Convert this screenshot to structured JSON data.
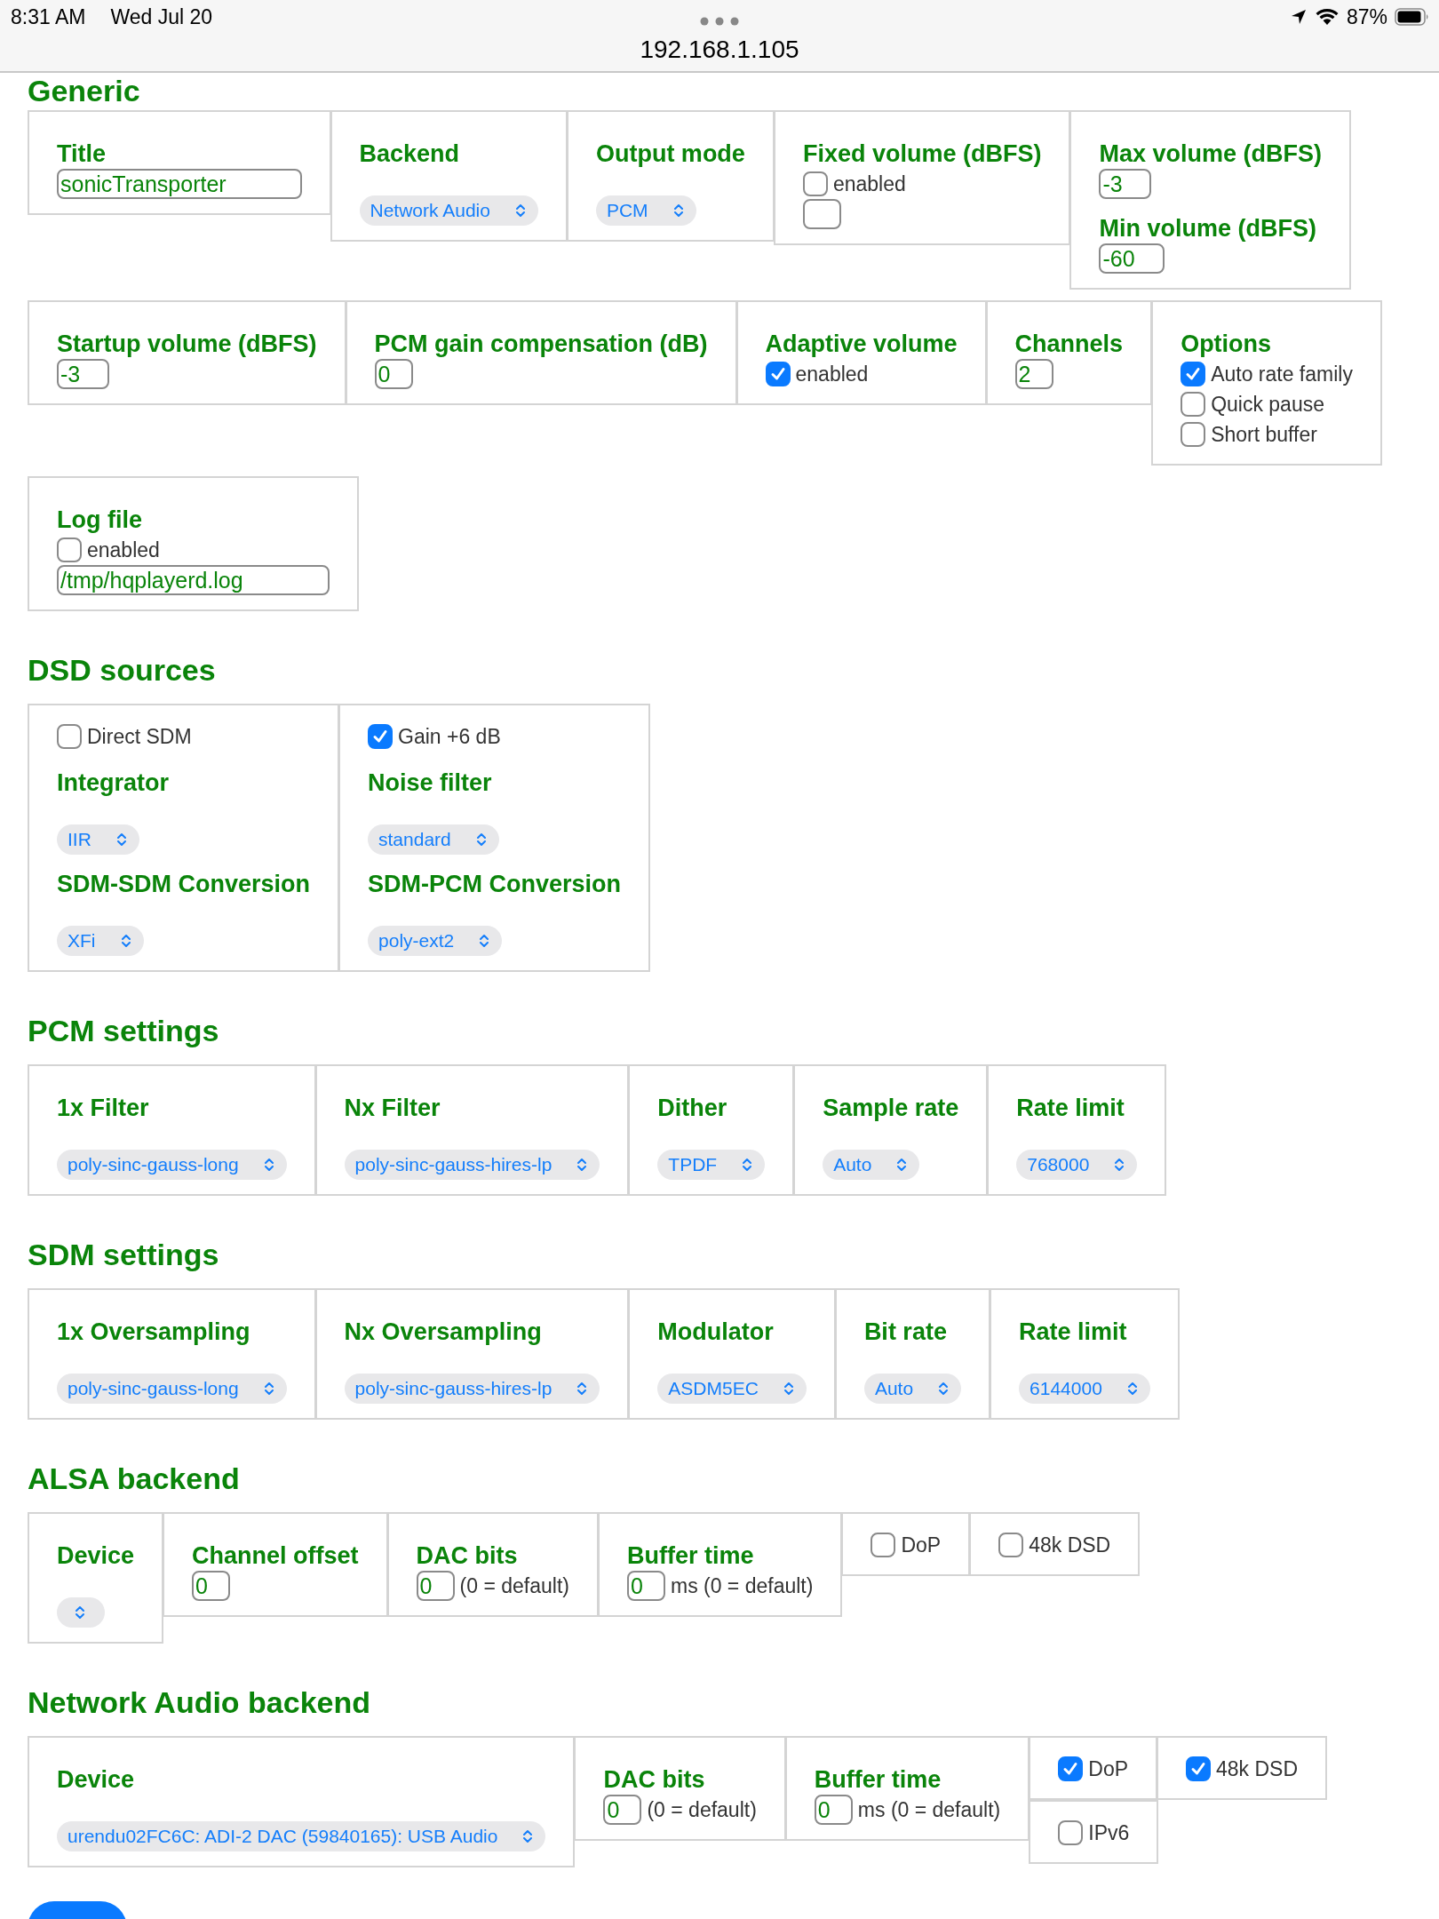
{
  "status_bar": {
    "time": "8:31 AM",
    "date": "Wed Jul 20",
    "battery": "87%"
  },
  "address_bar": {
    "url": "192.168.1.105"
  },
  "sections": [
    {
      "title": "Generic",
      "cells": [
        {
          "items": [
            {
              "kind": "label",
              "text": "Title"
            },
            {
              "kind": "input",
              "value": "sonicTransporter"
            }
          ]
        },
        {
          "items": [
            {
              "kind": "label",
              "text": "Backend"
            },
            {
              "kind": "select",
              "value": "Network Audio"
            }
          ]
        },
        {
          "items": [
            {
              "kind": "label",
              "text": "Output mode"
            },
            {
              "kind": "select",
              "value": "PCM"
            }
          ]
        },
        {
          "items": [
            {
              "kind": "label",
              "text": "Fixed volume (dBFS)"
            },
            {
              "kind": "checkbox",
              "label": "enabled",
              "checked": false
            },
            {
              "kind": "input"
            }
          ]
        },
        {
          "items": [
            {
              "kind": "label",
              "text": "Max volume (dBFS)"
            },
            {
              "kind": "input",
              "value": "-3"
            },
            {
              "kind": "label",
              "text": "Min volume (dBFS)"
            },
            {
              "kind": "input",
              "value": "-60"
            }
          ]
        },
        {
          "items": [
            {
              "kind": "label",
              "text": "Startup volume (dBFS)"
            },
            {
              "kind": "input",
              "value": "-3"
            }
          ]
        },
        {
          "items": [
            {
              "kind": "label",
              "text": "PCM gain compensation (dB)"
            },
            {
              "kind": "input",
              "value": "0"
            }
          ]
        },
        {
          "items": [
            {
              "kind": "label",
              "text": "Adaptive volume"
            },
            {
              "kind": "checkbox",
              "label": "enabled",
              "checked": true
            }
          ]
        },
        {
          "items": [
            {
              "kind": "label",
              "text": "Channels"
            },
            {
              "kind": "input",
              "value": "2"
            }
          ]
        },
        {
          "items": [
            {
              "kind": "label",
              "text": "Options"
            },
            {
              "kind": "checkbox",
              "label": "Auto rate family",
              "checked": true
            },
            {
              "kind": "checkbox",
              "label": "Quick pause",
              "checked": false
            },
            {
              "kind": "checkbox",
              "label": "Short buffer",
              "checked": false
            }
          ]
        },
        {
          "items": [
            {
              "kind": "label",
              "text": "Log file"
            },
            {
              "kind": "checkbox",
              "label": "enabled",
              "checked": false
            },
            {
              "kind": "input",
              "value": "/tmp/hqplayerd.log"
            }
          ]
        }
      ]
    },
    {
      "title": "DSD sources",
      "cells": [
        {
          "items": [
            {
              "kind": "checkbox",
              "label": "Direct SDM",
              "checked": false
            },
            {
              "kind": "label",
              "text": "Integrator"
            },
            {
              "kind": "select",
              "value": "IIR"
            },
            {
              "kind": "label",
              "text": "SDM-SDM Conversion"
            },
            {
              "kind": "select",
              "value": "XFi"
            }
          ]
        },
        {
          "items": [
            {
              "kind": "checkbox",
              "label": "Gain +6 dB",
              "checked": true
            },
            {
              "kind": "label",
              "text": "Noise filter"
            },
            {
              "kind": "select",
              "value": "standard"
            },
            {
              "kind": "label",
              "text": "SDM-PCM Conversion"
            },
            {
              "kind": "select",
              "value": "poly-ext2"
            }
          ]
        }
      ]
    },
    {
      "title": "PCM settings",
      "cells": [
        {
          "items": [
            {
              "kind": "label",
              "text": "1x Filter"
            },
            {
              "kind": "select",
              "value": "poly-sinc-gauss-long"
            }
          ]
        },
        {
          "items": [
            {
              "kind": "label",
              "text": "Nx Filter"
            },
            {
              "kind": "select",
              "value": "poly-sinc-gauss-hires-lp"
            }
          ]
        },
        {
          "items": [
            {
              "kind": "label",
              "text": "Dither"
            },
            {
              "kind": "select",
              "value": "TPDF"
            }
          ]
        },
        {
          "items": [
            {
              "kind": "label",
              "text": "Sample rate"
            },
            {
              "kind": "select",
              "value": "Auto"
            }
          ]
        },
        {
          "items": [
            {
              "kind": "label",
              "text": "Rate limit"
            },
            {
              "kind": "select",
              "value": "768000"
            }
          ]
        }
      ]
    },
    {
      "title": "SDM settings",
      "cells": [
        {
          "items": [
            {
              "kind": "label",
              "text": "1x Oversampling"
            },
            {
              "kind": "select",
              "value": "poly-sinc-gauss-long"
            }
          ]
        },
        {
          "items": [
            {
              "kind": "label",
              "text": "Nx Oversampling"
            },
            {
              "kind": "select",
              "value": "poly-sinc-gauss-hires-lp"
            }
          ]
        },
        {
          "items": [
            {
              "kind": "label",
              "text": "Modulator"
            },
            {
              "kind": "select",
              "value": "ASDM5EC"
            }
          ]
        },
        {
          "items": [
            {
              "kind": "label",
              "text": "Bit rate"
            },
            {
              "kind": "select",
              "value": "Auto"
            }
          ]
        },
        {
          "items": [
            {
              "kind": "label",
              "text": "Rate limit"
            },
            {
              "kind": "select",
              "value": "6144000"
            }
          ]
        }
      ]
    },
    {
      "title": "ALSA backend",
      "cells": [
        {
          "items": [
            {
              "kind": "label",
              "text": "Device"
            },
            {
              "kind": "select"
            }
          ]
        },
        {
          "items": [
            {
              "kind": "label",
              "text": "Channel offset"
            },
            {
              "kind": "input",
              "value": "0"
            }
          ]
        },
        {
          "items": [
            {
              "kind": "label",
              "text": "DAC bits"
            },
            {
              "kind": "input",
              "value": "0",
              "unit": "(0 = default)"
            }
          ]
        },
        {
          "items": [
            {
              "kind": "label",
              "text": "Buffer time"
            },
            {
              "kind": "input",
              "value": "0",
              "unit": "ms (0 = default)"
            }
          ]
        },
        {
          "items": [
            {
              "kind": "checkbox",
              "label": "DoP",
              "checked": false
            }
          ]
        },
        {
          "items": [
            {
              "kind": "checkbox",
              "label": "48k DSD",
              "checked": false
            }
          ]
        }
      ]
    },
    {
      "title": "Network Audio backend",
      "cells": [
        {
          "items": [
            {
              "kind": "label",
              "text": "Device"
            },
            {
              "kind": "select",
              "value": "urendu02FC6C: ADI-2 DAC (59840165): USB Audio"
            }
          ]
        },
        {
          "items": [
            {
              "kind": "label",
              "text": "DAC bits"
            },
            {
              "kind": "input",
              "value": "0",
              "unit": "(0 = default)"
            }
          ]
        },
        {
          "items": [
            {
              "kind": "label",
              "text": "Buffer time"
            },
            {
              "kind": "input",
              "value": "0",
              "unit": "ms (0 = default)"
            }
          ]
        },
        {
          "items": [
            {
              "kind": "checkbox",
              "label": "DoP",
              "checked": true
            }
          ]
        },
        {
          "items": [
            {
              "kind": "checkbox",
              "label": "48k DSD",
              "checked": true
            }
          ]
        },
        {
          "items": [
            {
              "kind": "checkbox",
              "label": "IPv6",
              "checked": false
            }
          ]
        }
      ]
    }
  ]
}
